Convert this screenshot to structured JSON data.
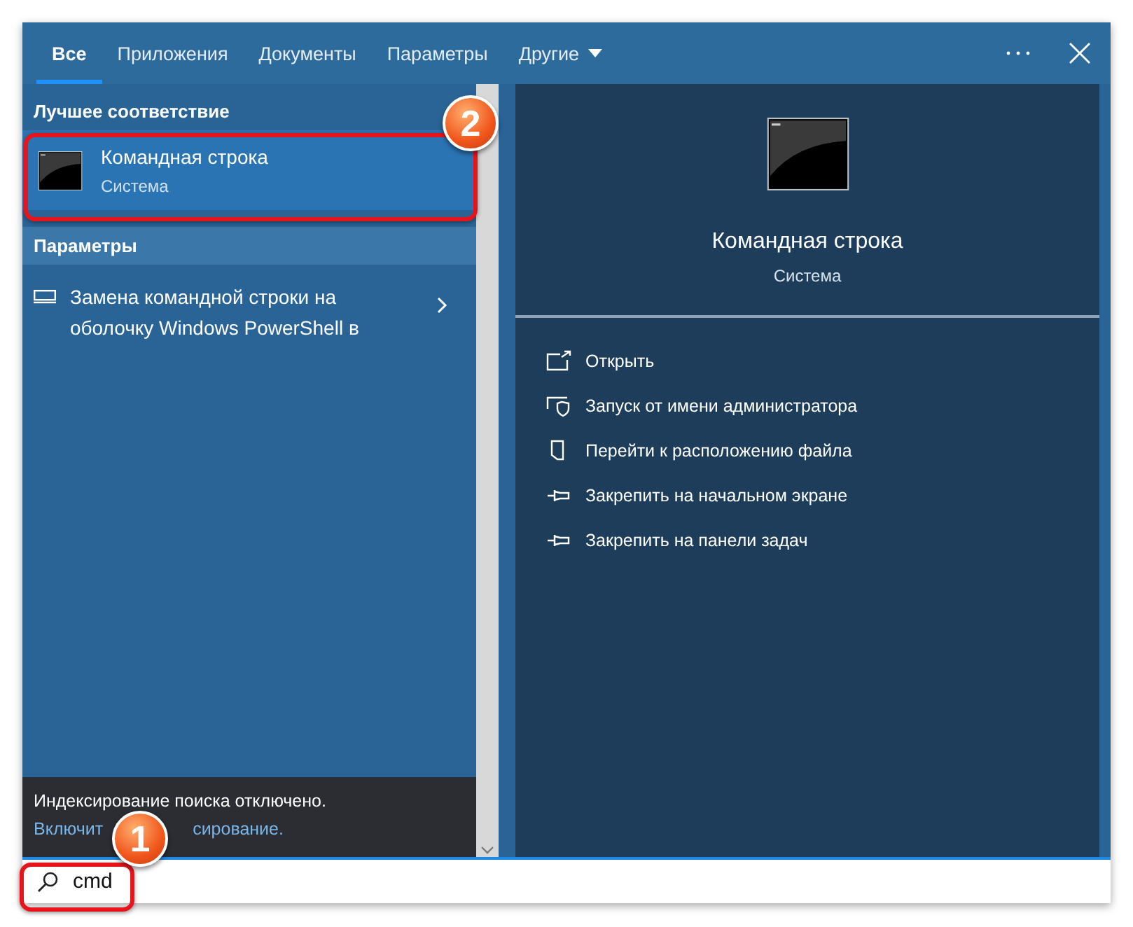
{
  "tabs": [
    {
      "label": "Все",
      "selected": true,
      "kind": "plain"
    },
    {
      "label": "Приложения",
      "selected": false,
      "kind": "plain"
    },
    {
      "label": "Документы",
      "selected": false,
      "kind": "plain"
    },
    {
      "label": "Параметры",
      "selected": false,
      "kind": "plain"
    },
    {
      "label": "Другие",
      "selected": false,
      "kind": "dropdown"
    }
  ],
  "best_match": {
    "heading": "Лучшее соответствие",
    "title": "Командная строка",
    "subtitle": "Система",
    "selected": true
  },
  "settings": {
    "heading": "Параметры",
    "items": [
      {
        "text": "Замена командной строки на оболочку Windows PowerShell в"
      }
    ]
  },
  "footer": {
    "message": "Индексирование поиска отключено.",
    "link_parts": [
      "Включит",
      "сирование."
    ]
  },
  "preview": {
    "title": "Командная строка",
    "subtitle": "Система",
    "actions": [
      {
        "label": "Открыть",
        "kind": "open"
      },
      {
        "label": "Запуск от имени администратора",
        "kind": "admin"
      },
      {
        "label": "Перейти к расположению файла",
        "kind": "location"
      },
      {
        "label": "Закрепить на начальном экране",
        "kind": "pin"
      },
      {
        "label": "Закрепить на панели задач",
        "kind": "pin"
      }
    ]
  },
  "search": {
    "value": "cmd"
  },
  "callouts": [
    {
      "number": "2",
      "kind": "best_match"
    },
    {
      "number": "1",
      "kind": "search"
    }
  ]
}
